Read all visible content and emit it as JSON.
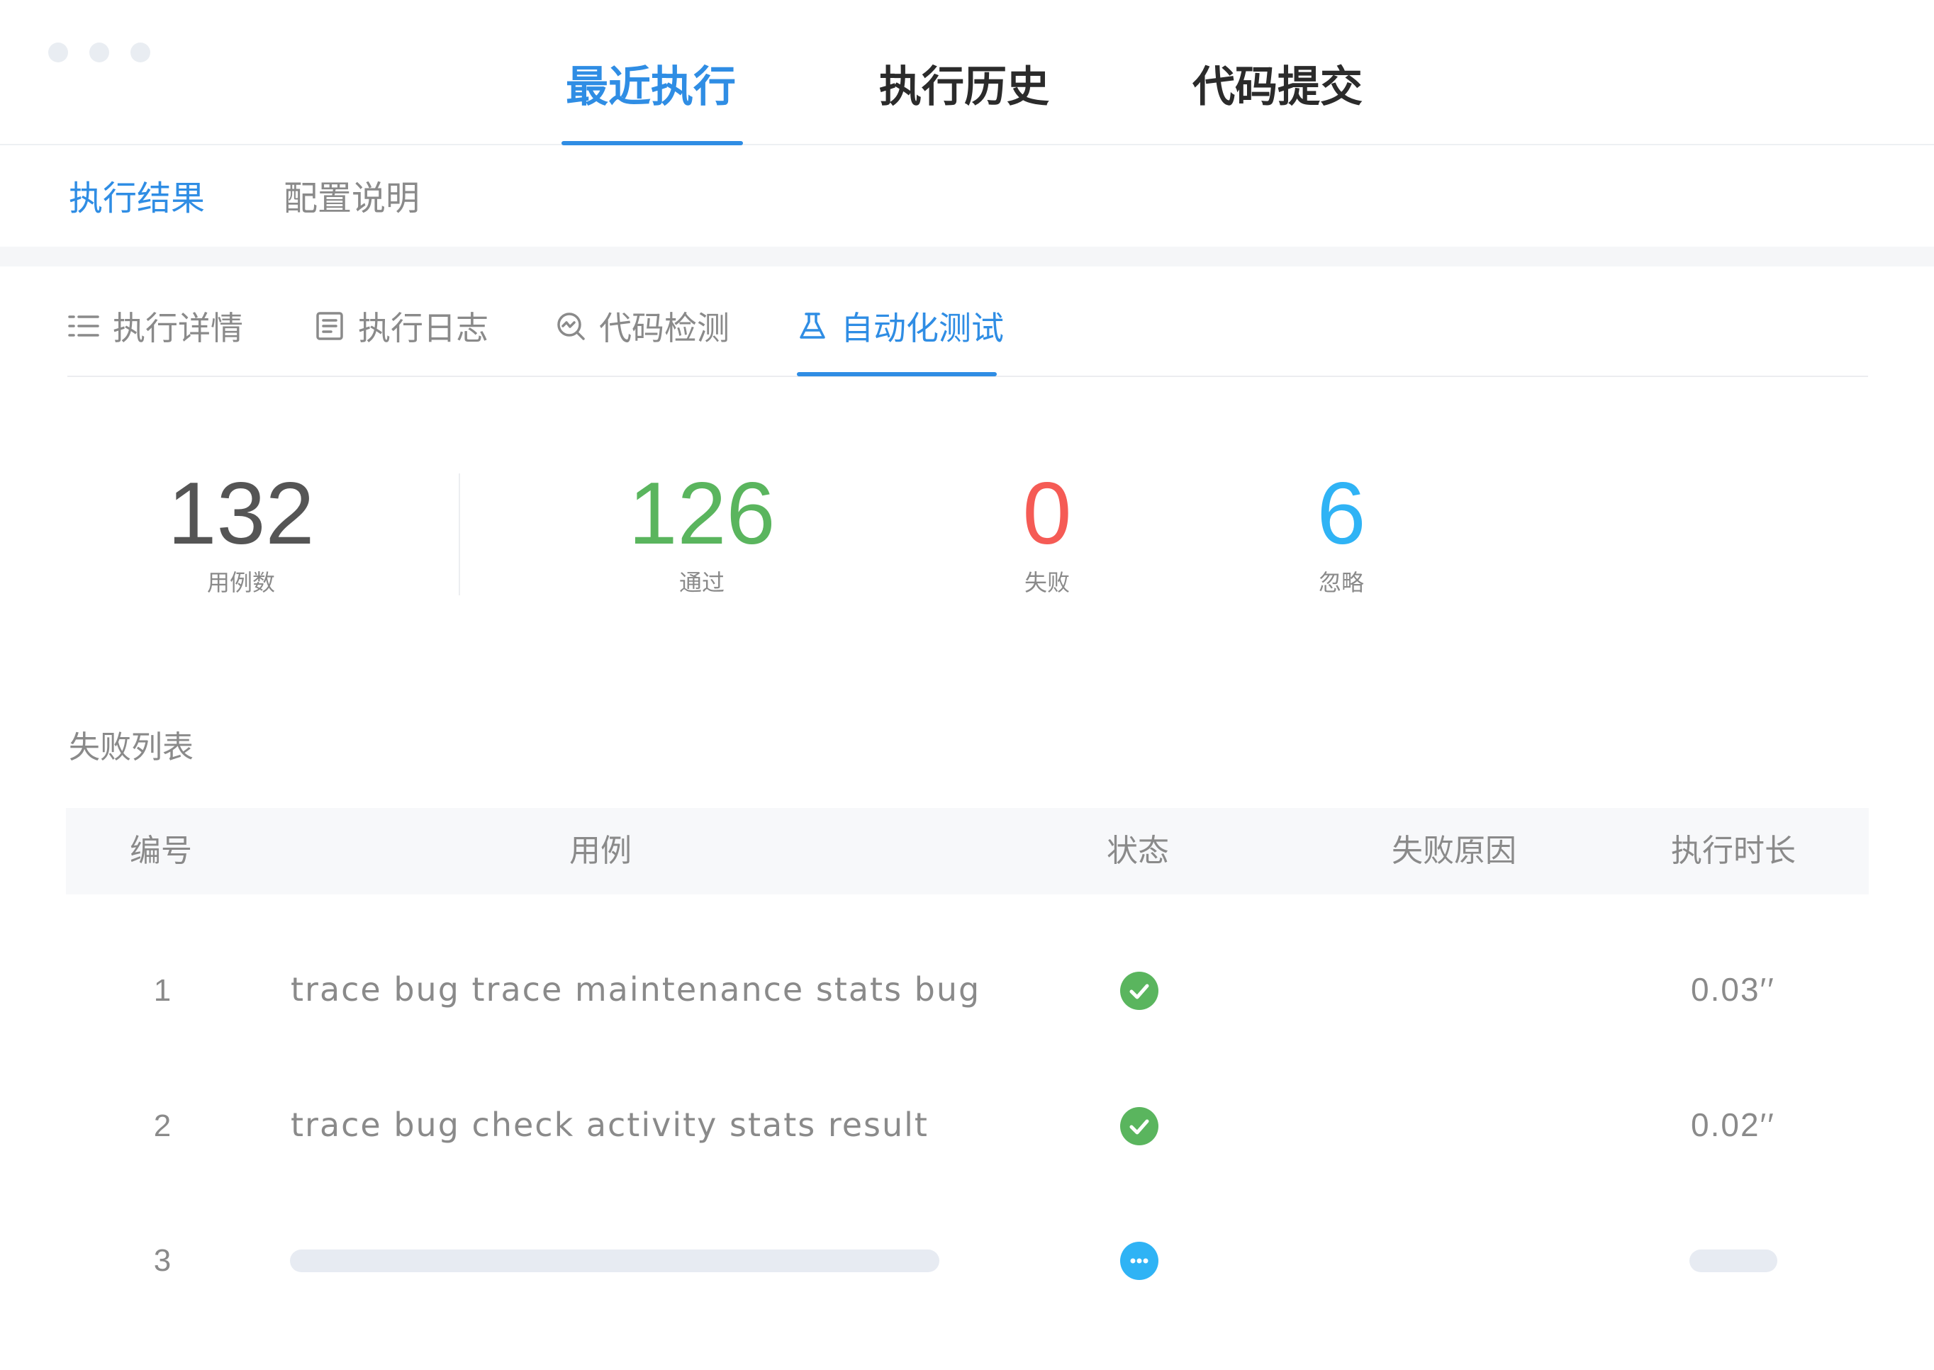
{
  "colors": {
    "accent": "#2f8de4",
    "total": "#555555",
    "passed": "#5ab55e",
    "failed": "#f55b55",
    "ignored": "#2fb3f5",
    "pass_icon": "#5ab55e",
    "pending_icon": "#2fb3f5"
  },
  "top_tabs": [
    {
      "label": "最近执行",
      "active": true
    },
    {
      "label": "执行历史",
      "active": false
    },
    {
      "label": "代码提交",
      "active": false
    }
  ],
  "sub_tabs": [
    {
      "label": "执行结果",
      "active": true
    },
    {
      "label": "配置说明",
      "active": false
    }
  ],
  "detail_tabs": [
    {
      "label": "执行详情",
      "icon": "list-icon",
      "active": false
    },
    {
      "label": "执行日志",
      "icon": "log-icon",
      "active": false
    },
    {
      "label": "代码检测",
      "icon": "code-scan-icon",
      "active": false
    },
    {
      "label": "自动化测试",
      "icon": "flask-icon",
      "active": true
    }
  ],
  "stats": {
    "total": {
      "value": "132",
      "label": "用例数"
    },
    "passed": {
      "value": "126",
      "label": "通过"
    },
    "failed": {
      "value": "0",
      "label": "失败"
    },
    "ignored": {
      "value": "6",
      "label": "忽略"
    }
  },
  "failure_list": {
    "title": "失败列表",
    "columns": [
      "编号",
      "用例",
      "状态",
      "失败原因",
      "执行时长"
    ],
    "rows": [
      {
        "no": "1",
        "case": "trace bug trace maintenance stats bug",
        "status": "passed",
        "status_icon": "check-circle-icon",
        "reason": "",
        "duration": "0.03′′"
      },
      {
        "no": "2",
        "case": "trace bug check activity stats result",
        "status": "passed",
        "status_icon": "check-circle-icon",
        "reason": "",
        "duration": "0.02′′"
      },
      {
        "no": "3",
        "case": "",
        "status": "pending",
        "status_icon": "more-dots-icon",
        "reason": "",
        "duration": ""
      }
    ]
  }
}
